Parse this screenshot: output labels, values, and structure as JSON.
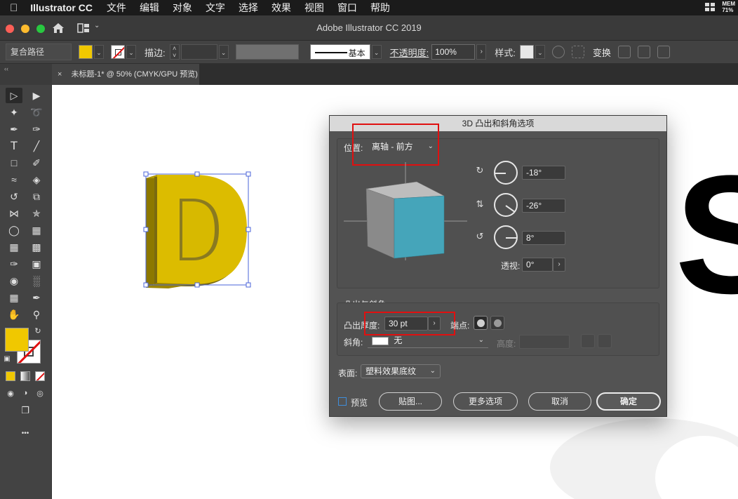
{
  "menubar": {
    "app_name": "Illustrator CC",
    "items": [
      "文件",
      "编辑",
      "对象",
      "文字",
      "选择",
      "效果",
      "视图",
      "窗口",
      "帮助"
    ],
    "mem_label": "MEM",
    "mem_value": "71%"
  },
  "window": {
    "title": "Adobe Illustrator CC 2019"
  },
  "control_bar": {
    "object_type": "复合路径",
    "stroke_label": "描边:",
    "brush_label": "基本",
    "opacity_label": "不透明度:",
    "opacity_value": "100%",
    "style_label": "样式:",
    "transform_label": "变换"
  },
  "document_tab": {
    "close": "×",
    "title": "未标题-1* @ 50% (CMYK/GPU 预览)"
  },
  "collapse_glyph": "‹‹",
  "toolbar": {
    "more": "•••"
  },
  "canvas_art": {
    "letter_left": "D",
    "letter_right": "S"
  },
  "dialog": {
    "title": "3D 凸出和斜角选项",
    "position_label": "位置:",
    "position_value": "离轴 - 前方",
    "rotation_x": "-18°",
    "rotation_y": "-26°",
    "rotation_z": "8°",
    "perspective_label": "透视:",
    "perspective_value": "0°",
    "extrude_section_label": "凸出与斜角",
    "extrude_depth_label": "凸出厚度:",
    "extrude_depth_value": "30 pt",
    "cap_label": "端点:",
    "bevel_label": "斜角:",
    "bevel_value": "无",
    "height_label": "高度:",
    "surface_label": "表面:",
    "surface_value": "塑料效果底纹",
    "preview_label": "预览",
    "map_button": "贴图...",
    "more_options_button": "更多选项",
    "cancel_button": "取消",
    "ok_button": "确定"
  },
  "colors": {
    "fill": "#f0c800",
    "cube_front": "#45a5ba",
    "cube_side": "#8a8a8a",
    "cube_top": "#bdbdbd",
    "highlight": "#e01010"
  }
}
